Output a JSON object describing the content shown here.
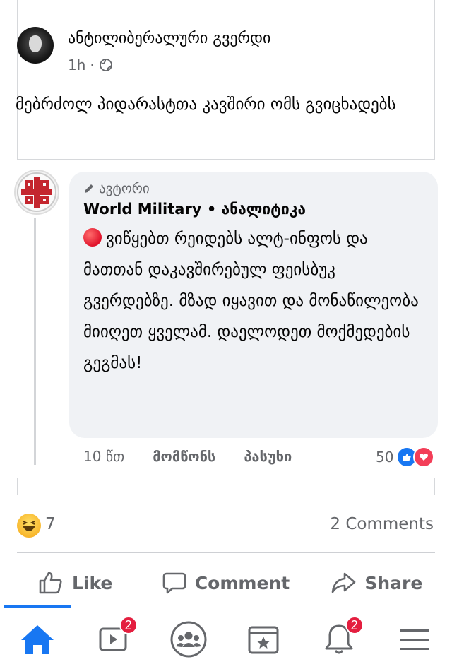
{
  "post": {
    "author": "ანტილიბერალური გვერდი",
    "time": "1h",
    "separator": "·",
    "text": "მებრძოლ პიდარასტთა კავშირი ომს გვიცხადებს"
  },
  "comment": {
    "badge": "ავტორი",
    "author": "World Military",
    "author_suffix": "• ანალიტიკა",
    "body": "ვიწყებთ რეიდებს ალტ-ინფოს და მათთან დაკავშირებულ ფეისბუკ გვერდებზე. მზად იყავით და მონაწილეობა მიიღეთ ყველამ. დაელოდეთ მოქმედების გეგმას!",
    "time": "10 წთ",
    "like": "მომწონს",
    "reply": "პასუხი",
    "reaction_count": "50"
  },
  "summary": {
    "reaction_count": "7",
    "comments": "2 Comments"
  },
  "actions": {
    "like": "Like",
    "comment": "Comment",
    "share": "Share"
  },
  "tabbar": {
    "videos_badge": "2",
    "notifications_badge": "2"
  },
  "colors": {
    "accent": "#1877f2",
    "badge": "#e41e3f",
    "muted": "#65676b"
  }
}
